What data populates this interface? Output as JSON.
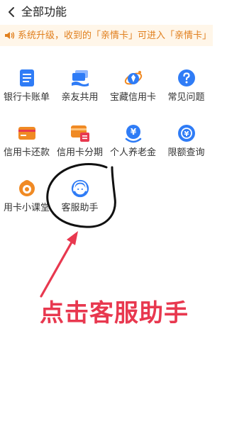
{
  "header": {
    "title": "全部功能",
    "back_icon": "chevron-left-icon"
  },
  "notice": {
    "icon": "speaker-icon",
    "text": "系统升级，收到的「亲情卡」可进入「亲情卡」",
    "color": "#e07f1d",
    "background": "#fff6e9"
  },
  "features": [
    {
      "label": "银行卡账单",
      "icon": "bill-icon"
    },
    {
      "label": "亲友共用",
      "icon": "shared-card-icon"
    },
    {
      "label": "宝藏信用卡",
      "icon": "treasure-card-icon"
    },
    {
      "label": "常见问题",
      "icon": "question-icon"
    },
    {
      "label": "信用卡还款",
      "icon": "card-repay-icon"
    },
    {
      "label": "信用卡分期",
      "icon": "card-installment-icon"
    },
    {
      "label": "个人养老金",
      "icon": "pension-icon"
    },
    {
      "label": "限额查询",
      "icon": "limit-query-icon"
    },
    {
      "label": "用卡小课堂",
      "icon": "card-class-icon"
    },
    {
      "label": "客服助手",
      "icon": "customer-service-icon"
    }
  ],
  "annotation": {
    "text": "点击客服助手",
    "color": "#e8384f",
    "highlight_color": "#111111"
  },
  "colors": {
    "primary_blue": "#2f7cf6",
    "accent_orange": "#f08a24",
    "accent_red": "#e8384f"
  }
}
